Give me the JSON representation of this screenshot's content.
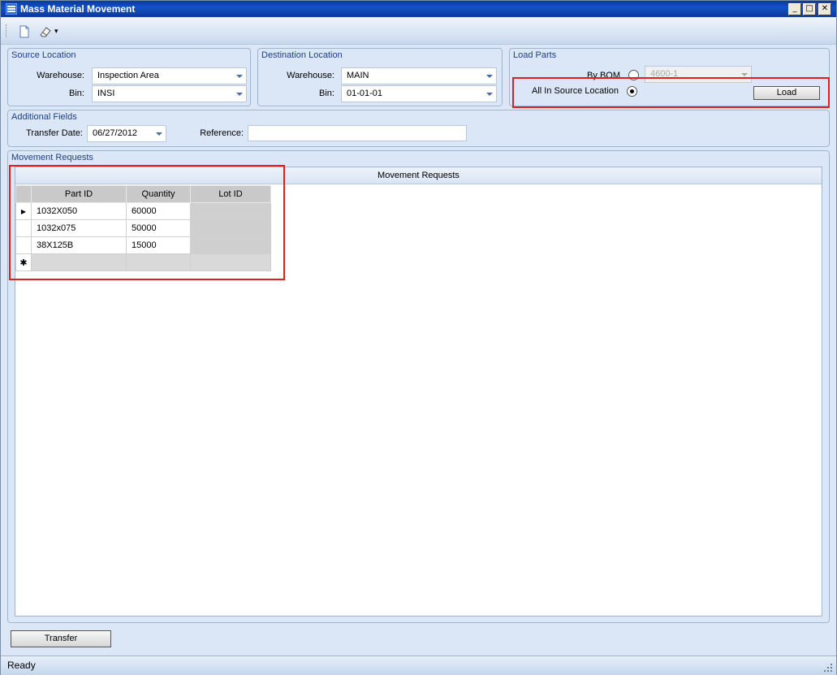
{
  "window": {
    "title": "Mass Material Movement",
    "app_icon": "app-menu-icon",
    "controls": {
      "minimize": "_",
      "maximize": "□",
      "close": "✕"
    }
  },
  "toolbar": {
    "items": [
      {
        "name": "new-icon"
      },
      {
        "name": "eraser-icon"
      }
    ],
    "dropdown_glyph": "▾"
  },
  "source_location": {
    "title": "Source Location",
    "warehouse_label": "Warehouse:",
    "warehouse_value": "Inspection Area",
    "bin_label": "Bin:",
    "bin_value": "INSI"
  },
  "destination_location": {
    "title": "Destination Location",
    "warehouse_label": "Warehouse:",
    "warehouse_value": "MAIN",
    "bin_label": "Bin:",
    "bin_value": "01-01-01"
  },
  "load_parts": {
    "title": "Load Parts",
    "by_bom_label": "By BOM",
    "bom_value": "4600-1",
    "all_in_source_label": "All In Source Location",
    "load_button": "Load"
  },
  "additional_fields": {
    "title": "Additional Fields",
    "transfer_date_label": "Transfer Date:",
    "transfer_date_value": "06/27/2012",
    "reference_label": "Reference:",
    "reference_value": ""
  },
  "movement_requests": {
    "group_title": "Movement Requests",
    "grid_title": "Movement Requests",
    "columns": [
      "Part ID",
      "Quantity",
      "Lot ID"
    ],
    "rows": [
      {
        "part_id": "1032X050",
        "quantity": "60000",
        "lot_id": ""
      },
      {
        "part_id": "1032x075",
        "quantity": "50000",
        "lot_id": ""
      },
      {
        "part_id": "38X125B",
        "quantity": "15000",
        "lot_id": ""
      }
    ],
    "current_row_glyph": "▶",
    "new_row_glyph": "✱"
  },
  "transfer_button": "Transfer",
  "status": "Ready",
  "colors": {
    "title_bar": "#0a3a9a",
    "panel_bg": "#dbe7f6",
    "group_title": "#1d3f8a",
    "highlight_box": "#e02020"
  }
}
